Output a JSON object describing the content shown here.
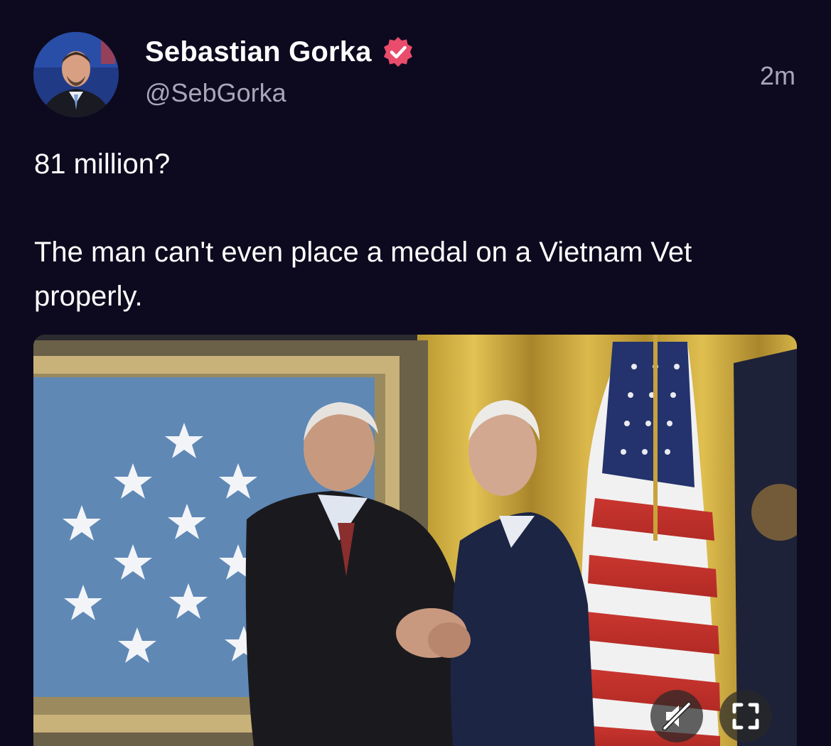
{
  "author": {
    "display_name": "Sebastian Gorka",
    "handle": "@SebGorka",
    "verified": true
  },
  "timestamp": "2m",
  "post": {
    "paragraphs": [
      "81 million?",
      "The man can't even place a medal on a Vietnam Vet properly."
    ]
  },
  "media": {
    "type": "video",
    "controls": [
      "muted-speaker-icon",
      "fullscreen-icon"
    ]
  },
  "colors": {
    "background": "#0d0a1f",
    "secondary_text": "#a9a6b8",
    "verified_badge": "#ea4c6b"
  }
}
